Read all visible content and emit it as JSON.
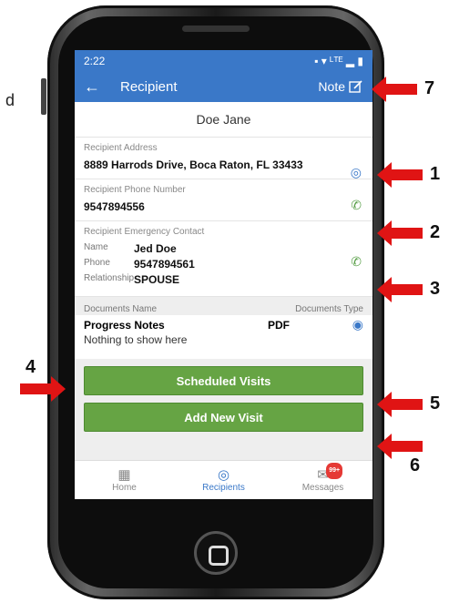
{
  "side_text": "d",
  "status": {
    "time": "2:22",
    "icons": "▪  ▾ ᴸᵀᴱ ▂ ▮"
  },
  "appbar": {
    "back": "←",
    "title": "Recipient",
    "note_label": "Note"
  },
  "recipient": {
    "name": "Doe Jane"
  },
  "address": {
    "label": "Recipient Address",
    "value": "8889 Harrods Drive, Boca Raton, FL 33433"
  },
  "phone": {
    "label": "Recipient Phone Number",
    "value": "9547894556"
  },
  "emergency": {
    "label": "Recipient Emergency Contact",
    "name_key": "Name",
    "name_value": "Jed Doe",
    "phone_key": "Phone",
    "phone_value": "9547894561",
    "rel_key": "Relationship",
    "rel_value": "SPOUSE"
  },
  "documents": {
    "name_header": "Documents Name",
    "type_header": "Documents Type",
    "item_name": "Progress Notes",
    "item_type": "PDF",
    "empty": "Nothing to show here"
  },
  "buttons": {
    "scheduled": "Scheduled Visits",
    "add_visit": "Add New Visit"
  },
  "nav": {
    "home": "Home",
    "recipients": "Recipients",
    "messages": "Messages",
    "badge": "99+"
  },
  "callouts": [
    "7",
    "1",
    "2",
    "3",
    "4",
    "5",
    "6"
  ],
  "colors": {
    "brand": "#3a78c8",
    "button": "#66a444",
    "arrow": "#e01414"
  }
}
